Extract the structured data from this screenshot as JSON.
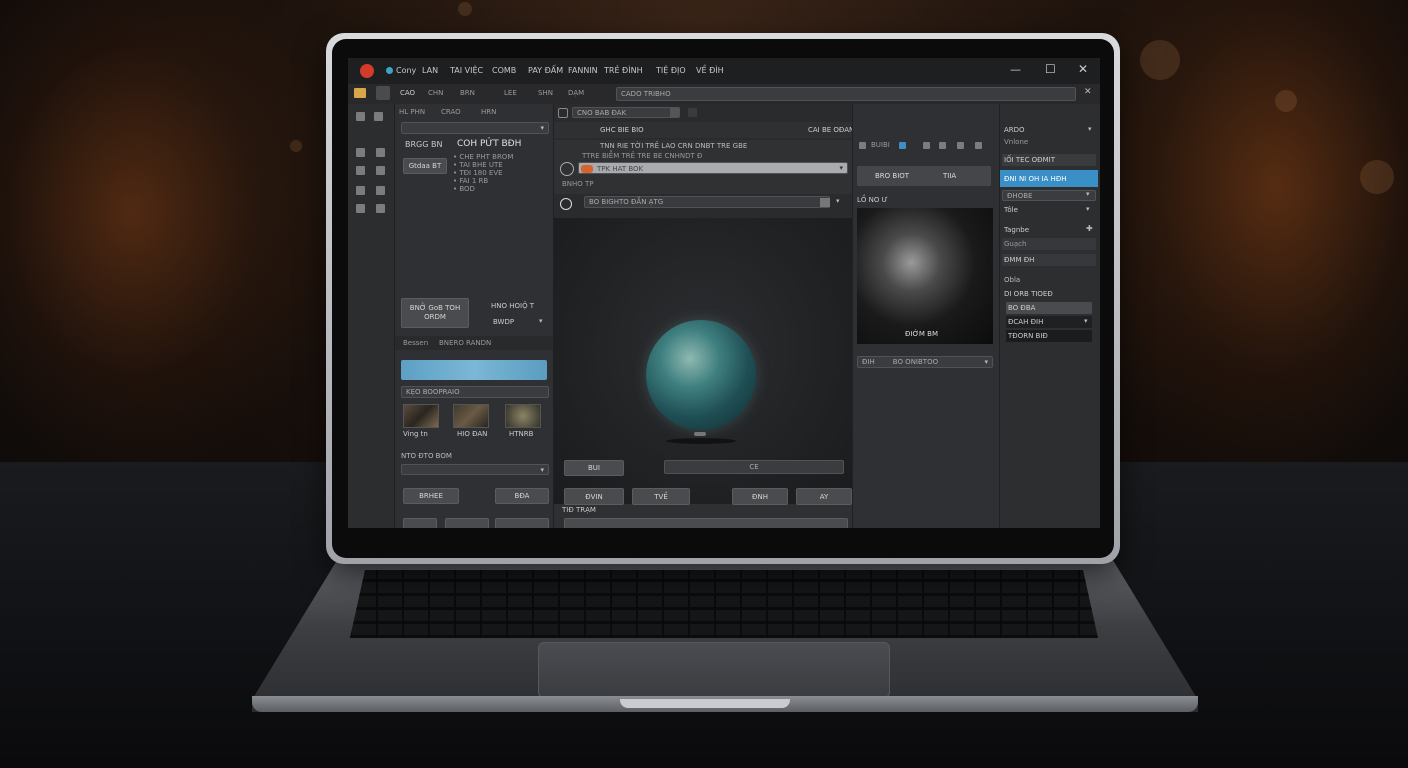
{
  "window": {
    "menu": [
      "Cony",
      "LAN",
      "TAI VIỆC",
      "COMB",
      "PAY ĐẤM",
      "FANNIN",
      "TRẺ ĐÌNH",
      "TIỆ ĐỊO",
      "VỀ ĐÌH"
    ],
    "minimize": "—",
    "maximize": "☐",
    "close": "✕"
  },
  "toolbar": {
    "items": [
      "CAO",
      "CHN",
      "BRN",
      "LEE",
      "SHN",
      "DẠM"
    ],
    "search_placeholder": "CADO TRIBHO",
    "close_icon": "✕"
  },
  "left_panel": {
    "tab_a": "HL PHN",
    "tab_b": "CRAO",
    "tab_c": "HRN",
    "heading": "COH PỬT BĐH",
    "mini_label": "BRGG BN",
    "button_label": "Gtdaa BT",
    "note_lines": [
      "• CHE PHT BROM",
      "• TAI BHE UTE",
      "• TĐI 180 EVE",
      "• FAI 1 RB",
      "• BOD"
    ],
    "action_button": "BNỞ GoB TOH ORDM",
    "side_text_a": "HNO HOIỘ T",
    "side_text_b": "BWDP",
    "sub_tab_a": "Bessen",
    "sub_tab_b": "BNERO RANDN",
    "select_value": "KẸO BOOPRAIO",
    "thumbs": [
      "Ving tn",
      "HIO ĐAN",
      "HTNRB"
    ],
    "section_label": "NTO ĐTO BOM",
    "btn_a": "BRHEE",
    "btn_b": "BĐA"
  },
  "center_panel": {
    "path_field": "CNO BAB ĐAK",
    "col_a": "GHC BIE BIO",
    "col_b": "CAI BE OĐAN",
    "row_title": "TNN RIE TỜI TRÊ LAO CRN DNBT TRE GBE",
    "row_sub": "TTRE BIỄM TRÊ TRE BE CNHNDT Đ",
    "select_primary": "TPK HAT BOK",
    "label_small": "BNHO TP",
    "select_secondary": "BO BIGHTO ĐẮN ẠTG",
    "footer_label": "TIĐ TRẠM",
    "bottom_btn_a": "BUI",
    "bottom_field": "CE",
    "bottom_btn_b": "ĐVIN",
    "bottom_btn_c": "TVỀ",
    "bottom_btn_d": "ĐNH",
    "bottom_btn_e": "AY"
  },
  "preview_panel": {
    "icons_label": "BUIBI",
    "tab_a": "BRO BIOT",
    "tab_b": "TIIA",
    "title": "LỒ NO Ư",
    "image_caption": "ĐIỚM BM",
    "select_a": "ĐIH",
    "select_b": "BO ONIBTOO"
  },
  "right_panel": {
    "header": "ARDO",
    "sub_a": "Vnlone",
    "sub_b": "IỐI TEC OĐMIT",
    "active_item": "ĐNI NI OH IA HĐH",
    "items": [
      "ĐHOBE",
      "Tôle"
    ],
    "section_a": "Tagnbe",
    "section_b": "Guạch",
    "section_c": "ĐMM ĐH",
    "section_d": "Obla",
    "section_e": "DI ORB TIOEĐ",
    "list": [
      "BO ĐBA",
      "ĐCAH ĐIH",
      "TĐORN BIĐ"
    ]
  },
  "colors": {
    "accent": "#3a8fc7",
    "logo": "#d23a2a",
    "field_accent": "#d5632d"
  }
}
